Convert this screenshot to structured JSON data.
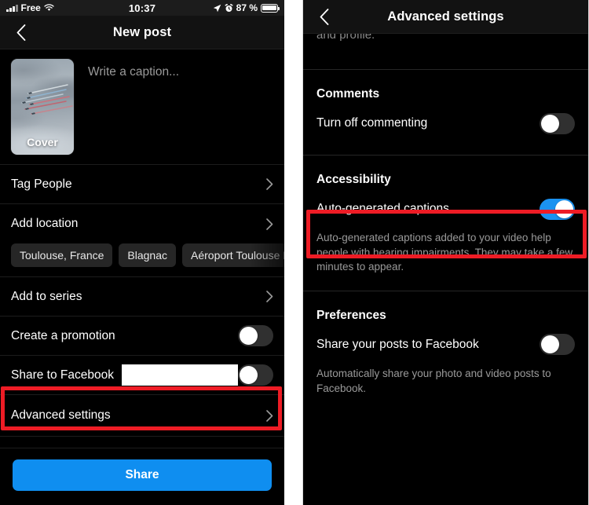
{
  "left_phone": {
    "status_bar": {
      "carrier": "Free",
      "time": "10:37",
      "battery_percent": "87 %",
      "icons": [
        "signal-bars-icon",
        "wifi-icon",
        "location-arrow-icon",
        "alarm-clock-icon",
        "battery-icon"
      ]
    },
    "nav": {
      "back_icon": "chevron-left-icon",
      "title": "New post"
    },
    "composer": {
      "cover_label": "Cover",
      "caption_placeholder": "Write a caption...",
      "caption_value": ""
    },
    "rows": [
      {
        "label": "Tag People",
        "accessory": "chevron-right-icon"
      },
      {
        "label": "Add location",
        "accessory": "chevron-right-icon"
      }
    ],
    "location_chips": [
      "Toulouse, France",
      "Blagnac",
      "Aéroport Toulouse B"
    ],
    "rows2": [
      {
        "label": "Add to series",
        "accessory": "chevron-right-icon"
      }
    ],
    "toggles": [
      {
        "label": "Create a promotion",
        "state": "off"
      },
      {
        "label": "Share to Facebook",
        "state": "off",
        "redacted": true
      }
    ],
    "advanced_settings": {
      "label": "Advanced settings",
      "accessory": "chevron-right-icon"
    },
    "share_button": "Share"
  },
  "right_phone": {
    "nav": {
      "back_icon": "chevron-left-icon",
      "title": "Advanced settings"
    },
    "scrolled_text": "and profile.",
    "sections": [
      {
        "heading": "Comments",
        "rows": [
          {
            "label": "Turn off commenting",
            "state": "off"
          }
        ],
        "helper": ""
      },
      {
        "heading": "Accessibility",
        "rows": [
          {
            "label": "Auto-generated captions",
            "state": "on"
          }
        ],
        "helper": "Auto-generated captions added to your video help people with hearing impairments. They may take a few minutes to appear."
      },
      {
        "heading": "Preferences",
        "rows": [
          {
            "label": "Share your posts to Facebook",
            "state": "off"
          }
        ],
        "helper": "Automatically share your photo and video posts to Facebook."
      }
    ]
  },
  "annotations": {
    "highlight_color": "#ee1c25",
    "boxes": [
      "advanced-settings-row",
      "auto-generated-captions-row"
    ]
  },
  "colors": {
    "background": "#000000",
    "toggle_on": "#1b92f0",
    "toggle_off": "#303030",
    "share_button": "#0f8ef0",
    "highlight": "#ee1c25",
    "secondary_text": "#9a9a9a"
  }
}
